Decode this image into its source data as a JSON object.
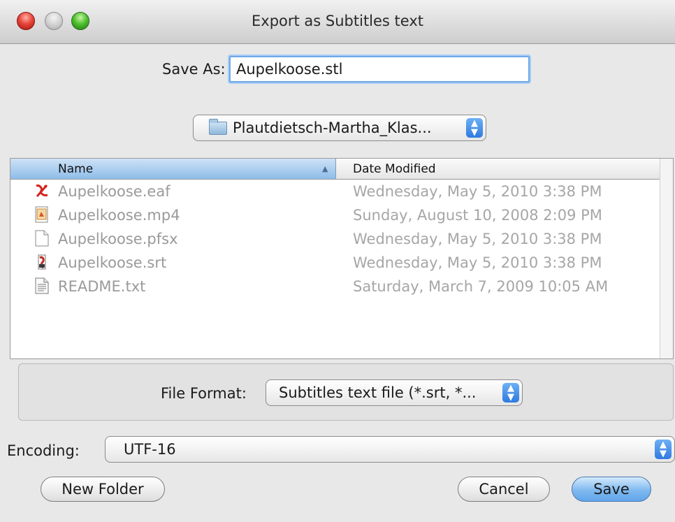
{
  "window": {
    "title": "Export as Subtitles text"
  },
  "save_as": {
    "label": "Save As:",
    "value": "Aupelkoose.stl"
  },
  "location": {
    "folder": "Plautdietsch-Martha_Klas..."
  },
  "browser": {
    "columns": {
      "name": "Name",
      "date": "Date Modified"
    },
    "files": [
      {
        "name": "Aupelkoose.eaf",
        "date": "Wednesday, May 5, 2010 3:38 PM",
        "icon": "elan-file-icon"
      },
      {
        "name": "Aupelkoose.mp4",
        "date": "Sunday, August 10, 2008 2:09 PM",
        "icon": "video-file-icon"
      },
      {
        "name": "Aupelkoose.pfsx",
        "date": "Wednesday, May 5, 2010 3:38 PM",
        "icon": "blank-document-icon"
      },
      {
        "name": "Aupelkoose.srt",
        "date": "Wednesday, May 5, 2010 3:38 PM",
        "icon": "subtitle-file-icon"
      },
      {
        "name": "README.txt",
        "date": "Saturday, March 7, 2009 10:05 AM",
        "icon": "text-document-icon"
      }
    ]
  },
  "format": {
    "label": "File Format:",
    "value": "Subtitles text file (*.srt, *..."
  },
  "encoding": {
    "label": "Encoding:",
    "value": "UTF-16"
  },
  "buttons": {
    "new_folder": "New Folder",
    "cancel": "Cancel",
    "save": "Save"
  }
}
